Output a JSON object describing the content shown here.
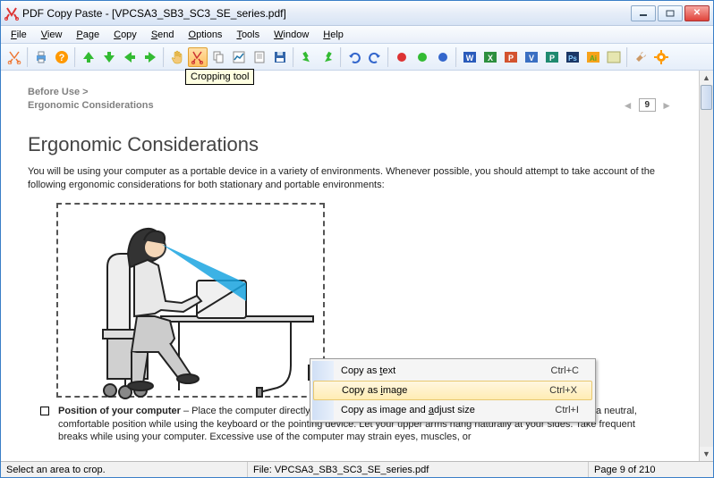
{
  "window": {
    "title": "PDF Copy Paste - [VPCSA3_SB3_SC3_SE_series.pdf]"
  },
  "menu": {
    "items": [
      "File",
      "View",
      "Page",
      "Copy",
      "Send",
      "Options",
      "Tools",
      "Window",
      "Help"
    ]
  },
  "tooltip": {
    "text": "Cropping tool"
  },
  "header": {
    "bc1": "Before Use >",
    "bc2": "Ergonomic Considerations",
    "pagenum": "9"
  },
  "doc_title": "Ergonomic Considerations",
  "intro": "You will be using your computer as a portable device in a variety of environments. Whenever possible, you should attempt to take account of the following ergonomic considerations for both stationary and portable environments:",
  "context_menu": {
    "items": [
      {
        "label": "Copy as text",
        "ul": "t",
        "shortcut": "Ctrl+C"
      },
      {
        "label": "Copy as image",
        "ul": "i",
        "shortcut": "Ctrl+X"
      },
      {
        "label": "Copy as image and adjust size",
        "ul": "a",
        "shortcut": "Ctrl+I"
      }
    ]
  },
  "bullet": {
    "title": "Position of your computer",
    "text": " – Place the computer directly in front of you. Keep your forearms horizontal, with your wrists in a neutral, comfortable position while using the keyboard or the pointing device. Let your upper arms hang naturally at your sides. Take frequent breaks while using your computer. Excessive use of the computer may strain eyes, muscles, or"
  },
  "status": {
    "left": "Select an area to crop.",
    "mid": "File: VPCSA3_SB3_SC3_SE_series.pdf",
    "right": "Page 9 of 210"
  },
  "icons": {
    "scissors": "scissors-icon",
    "print": "print-icon",
    "help": "help-icon",
    "up": "up-icon",
    "down": "down-icon",
    "left": "left-icon",
    "right": "right-icon",
    "hand": "hand-icon",
    "crop": "crop-icon",
    "copy": "copy-icon",
    "chart": "chart-icon",
    "page": "page-icon",
    "save": "save-icon",
    "rotleft": "rotate-left-icon",
    "rotright": "rotate-right-icon",
    "undo": "undo-icon",
    "redo": "redo-icon",
    "red": "dot-red-icon",
    "green": "dot-green-icon",
    "blue": "dot-blue-icon",
    "word": "word-icon",
    "excel": "excel-icon",
    "ppt": "powerpoint-icon",
    "visio": "visio-icon",
    "pub": "publisher-icon",
    "ps": "photoshop-icon",
    "ai": "illustrator-icon",
    "other": "app-icon",
    "wrench": "wrench-icon",
    "gear": "gear-icon"
  }
}
